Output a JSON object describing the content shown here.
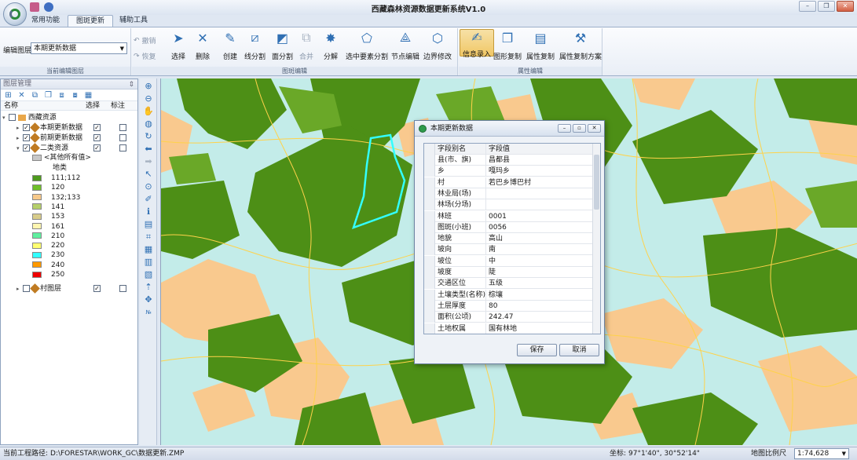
{
  "app": {
    "title": "西藏森林资源数据更新系统V1.0",
    "window_buttons": [
      "–",
      "❐",
      "✕"
    ]
  },
  "tabs": [
    {
      "label": "常用功能",
      "active": false
    },
    {
      "label": "图斑更新",
      "active": true
    },
    {
      "label": "辅助工具",
      "active": false
    }
  ],
  "ribbon": {
    "edit_layer_label": "编辑图层",
    "edit_layer_value": "本期更新数据",
    "undo": "撤销",
    "redo": "恢复",
    "group_current_layer": "当前编辑图层",
    "group_patch_edit": "图斑编辑",
    "group_attr_edit": "属性编辑",
    "buttons": {
      "select": "选择",
      "delete": "删除",
      "create": "创建",
      "line_split": "线分割",
      "polygon_split": "面分割",
      "merge": "合并",
      "explode": "分解",
      "select_split": "选中要素分割",
      "node_edit": "节点编辑",
      "boundary_fix": "边界修改",
      "info_entry": "信息录入",
      "shape_copy": "图形复制",
      "attr_copy": "属性复制",
      "attr_copy_scheme": "属性复制方案"
    }
  },
  "layers_panel": {
    "title": "图层管理",
    "col_name": "名称",
    "col_select": "选择",
    "col_label": "标注",
    "root": "西藏资源",
    "layers": [
      {
        "name": "本期更新数据",
        "visible": true,
        "select": true,
        "label": false
      },
      {
        "name": "前期更新数据",
        "visible": true,
        "select": true,
        "label": false
      },
      {
        "name": "二类资源",
        "visible": true,
        "select": true,
        "label": false
      }
    ],
    "other_values": "<其他所有值>",
    "field_name": "地类",
    "legend": [
      {
        "label": "111;112",
        "color": "#4e9a1e"
      },
      {
        "label": "120",
        "color": "#6fbf2a"
      },
      {
        "label": "132;133",
        "color": "#f7c98a"
      },
      {
        "label": "141",
        "color": "#b5cf6a"
      },
      {
        "label": "153",
        "color": "#d8cc8a"
      },
      {
        "label": "161",
        "color": "#fff6b0"
      },
      {
        "label": "210",
        "color": "#60f0a0"
      },
      {
        "label": "220",
        "color": "#ffff70"
      },
      {
        "label": "230",
        "color": "#33ffff"
      },
      {
        "label": "240",
        "color": "#ff9900"
      },
      {
        "label": "250",
        "color": "#ee0000"
      }
    ],
    "village_layer": {
      "name": "村图层",
      "visible": false,
      "select": true,
      "label": false
    }
  },
  "map_colors": {
    "background": "#c3ece9",
    "forest": "#4d8f16",
    "forest_light": "#6aa828",
    "shrub": "#f9c98e",
    "road": "#ffd24a",
    "selection": "#33ffff"
  },
  "dialog": {
    "title": "本期更新数据",
    "col_field": "字段别名",
    "col_value": "字段值",
    "rows": [
      {
        "field": "县(市、旗)",
        "value": "昌都县"
      },
      {
        "field": "乡",
        "value": "嘎玛乡"
      },
      {
        "field": "村",
        "value": "若巴乡博巴村"
      },
      {
        "field": "林业局(场)",
        "value": ""
      },
      {
        "field": "林场(分场)",
        "value": ""
      },
      {
        "field": "林班",
        "value": "0001"
      },
      {
        "field": "图斑(小班)",
        "value": "0056"
      },
      {
        "field": "地貌",
        "value": "高山"
      },
      {
        "field": "坡向",
        "value": "南"
      },
      {
        "field": "坡位",
        "value": "中"
      },
      {
        "field": "坡度",
        "value": "陡"
      },
      {
        "field": "交通区位",
        "value": "五级"
      },
      {
        "field": "土壤类型(名称)",
        "value": "棕壤"
      },
      {
        "field": "土层厚度",
        "value": "80"
      },
      {
        "field": "面积(公顷)",
        "value": "242.47"
      },
      {
        "field": "土地权属",
        "value": "国有林地"
      }
    ],
    "save": "保存",
    "cancel": "取消"
  },
  "status": {
    "project_path_label": "当前工程路径:",
    "project_path": "D:\\FORESTAR\\WORK_GC\\数据更新.ZMP",
    "coord_label": "坐标:",
    "coord": "97°1'40\", 30°52'14\"",
    "scale_label": "地图比例尺",
    "scale": "1:74,628"
  }
}
